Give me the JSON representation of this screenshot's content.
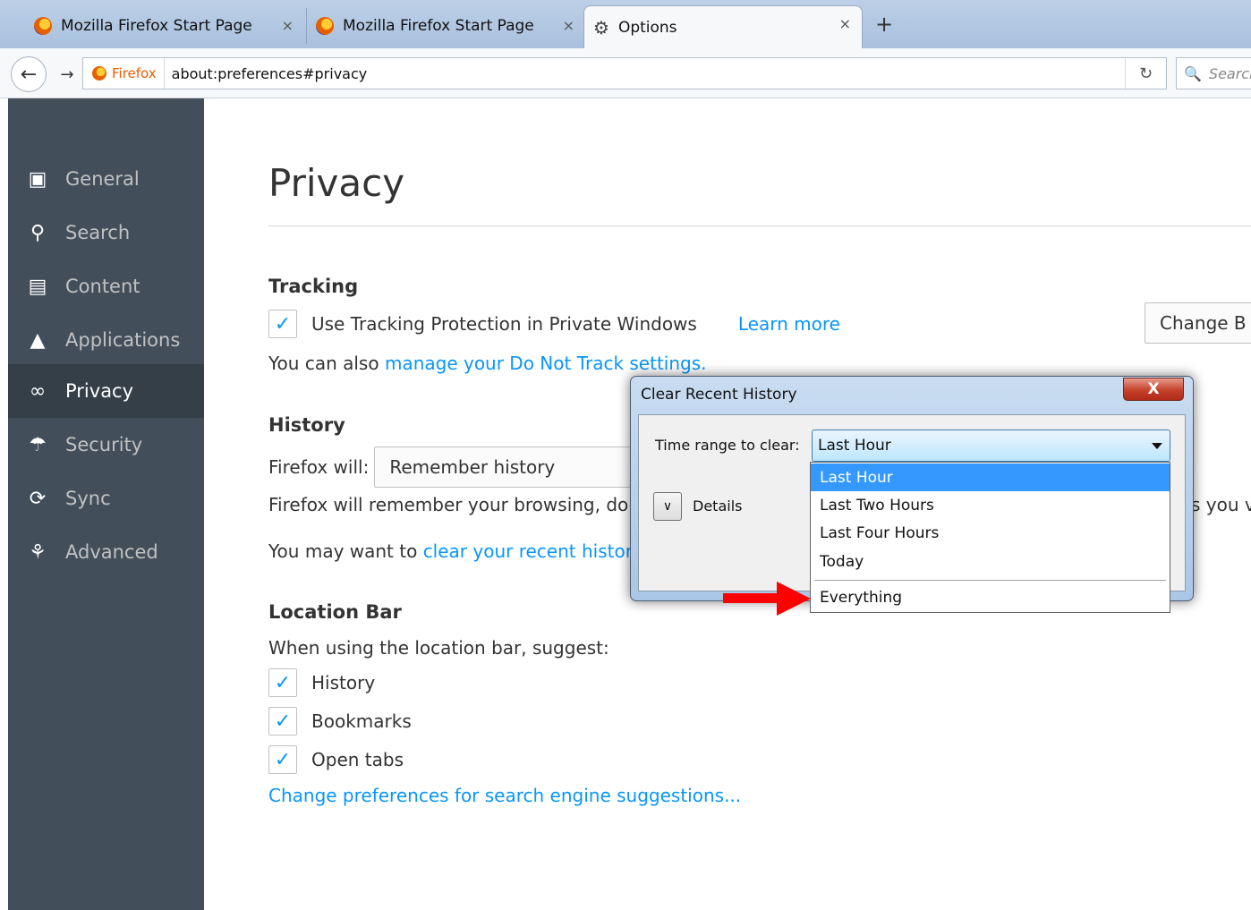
{
  "tabs": [
    {
      "label": "Mozilla Firefox Start Page",
      "close": "×"
    },
    {
      "label": "Mozilla Firefox Start Page",
      "close": "×"
    },
    {
      "label": "Options",
      "close": "×"
    }
  ],
  "new_tab": "+",
  "nav": {
    "identity_label": "Firefox",
    "url": "about:preferences#privacy",
    "search_placeholder": "Search"
  },
  "sidebar": {
    "items": [
      {
        "label": "General",
        "icon": "general-icon"
      },
      {
        "label": "Search",
        "icon": "search-icon"
      },
      {
        "label": "Content",
        "icon": "content-icon"
      },
      {
        "label": "Applications",
        "icon": "applications-icon"
      },
      {
        "label": "Privacy",
        "icon": "privacy-mask-icon",
        "active": true
      },
      {
        "label": "Security",
        "icon": "security-icon"
      },
      {
        "label": "Sync",
        "icon": "sync-icon"
      },
      {
        "label": "Advanced",
        "icon": "advanced-icon"
      }
    ]
  },
  "privacy": {
    "title": "Privacy",
    "tracking": {
      "heading": "Tracking",
      "checkbox_label": "Use Tracking Protection in Private Windows",
      "checkbox_checked": true,
      "learn_more": "Learn more",
      "change_button": "Change B",
      "dnt_prefix": "You can also ",
      "dnt_link": "manage your Do Not Track settings."
    },
    "history": {
      "heading": "History",
      "will_label": "Firefox will:",
      "will_value": "Remember history",
      "description": "Firefox will remember your browsing, do",
      "description_right": "s you v",
      "clear_prefix": "You may want to ",
      "clear_link": "clear your recent history"
    },
    "location_bar": {
      "heading": "Location Bar",
      "suggest_label": "When using the location bar, suggest:",
      "options": [
        {
          "label": "History",
          "checked": true
        },
        {
          "label": "Bookmarks",
          "checked": true
        },
        {
          "label": "Open tabs",
          "checked": true
        }
      ],
      "change_link": "Change preferences for search engine suggestions..."
    }
  },
  "dialog": {
    "title": "Clear Recent History",
    "close": "X",
    "time_range_label": "Time range to clear:",
    "selected": "Last Hour",
    "details_label": "Details",
    "options": [
      "Last Hour",
      "Last Two Hours",
      "Last Four Hours",
      "Today",
      "Everything"
    ]
  },
  "colors": {
    "sidebar_bg": "#424f5a",
    "sidebar_active": "#343f48",
    "link": "#0996f8",
    "dropdown_selected": "#3399ff",
    "annotation_arrow": "#ff0000"
  }
}
